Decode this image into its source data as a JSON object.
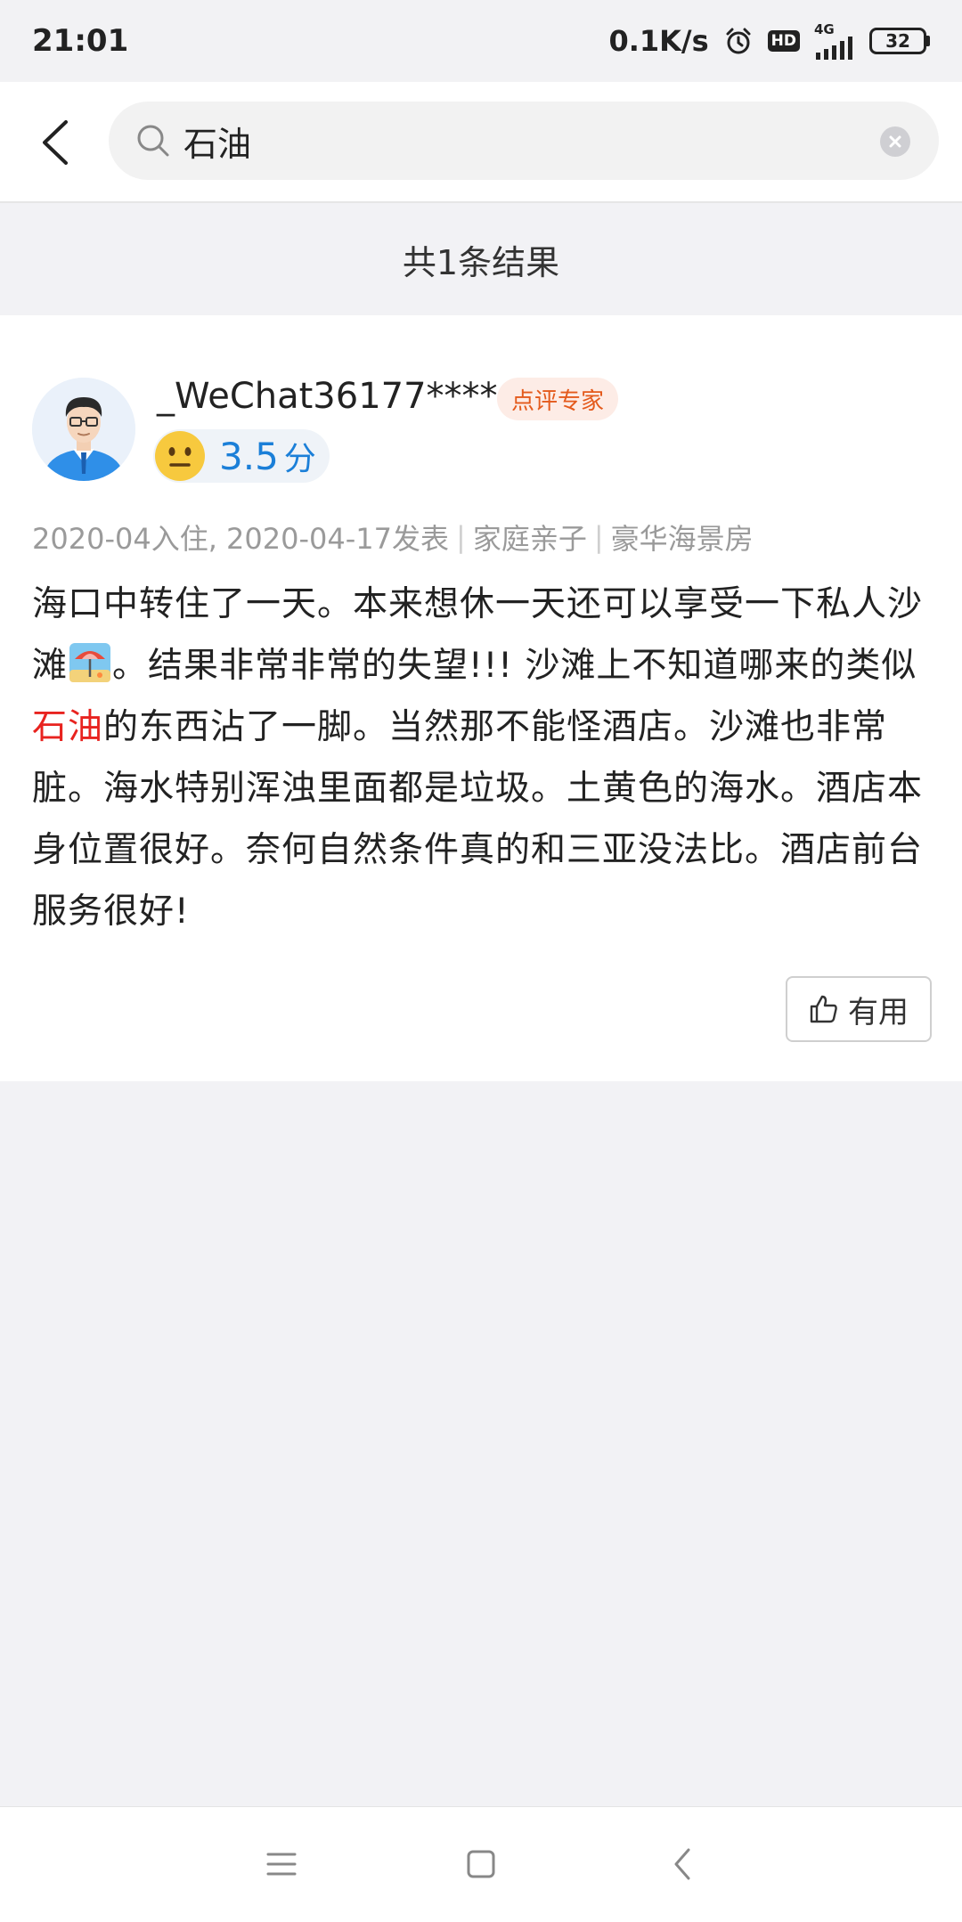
{
  "status_bar": {
    "time": "21:01",
    "network_speed": "0.1K/s",
    "hd_label": "HD",
    "network_type": "4G",
    "battery": "32",
    "icons": [
      "alarm-icon",
      "hd-icon",
      "signal-icon",
      "battery-icon"
    ]
  },
  "search": {
    "value": "石油",
    "icons": [
      "back-arrow-icon",
      "search-icon",
      "clear-icon"
    ]
  },
  "results": {
    "count_text": "共1条结果"
  },
  "review": {
    "username": "_WeChat36177****",
    "badge": "点评专家",
    "score": "3.5",
    "score_unit": "分",
    "meta": {
      "dates": "2020-04入住, 2020-04-17发表",
      "trip_type": "家庭亲子",
      "room_type": "豪华海景房"
    },
    "text_before_emoji": "海口中转住了一天。本来想休一天还可以享受一下私人沙滩",
    "text_after_emoji": "。结果非常非常的失望!!! 沙滩上不知道哪来的类似",
    "highlight": "石油",
    "text_after_highlight": "的东西沾了一脚。当然那不能怪酒店。沙滩也非常脏。海水特别浑浊里面都是垃圾。土黄色的海水。酒店本身位置很好。奈何自然条件真的和三亚没法比。酒店前台服务很好!",
    "useful_label": "有用"
  },
  "colors": {
    "accent_blue": "#1b7fd8",
    "highlight_red": "#e8231f",
    "badge_orange": "#e45a1c",
    "background": "#f2f2f5"
  }
}
